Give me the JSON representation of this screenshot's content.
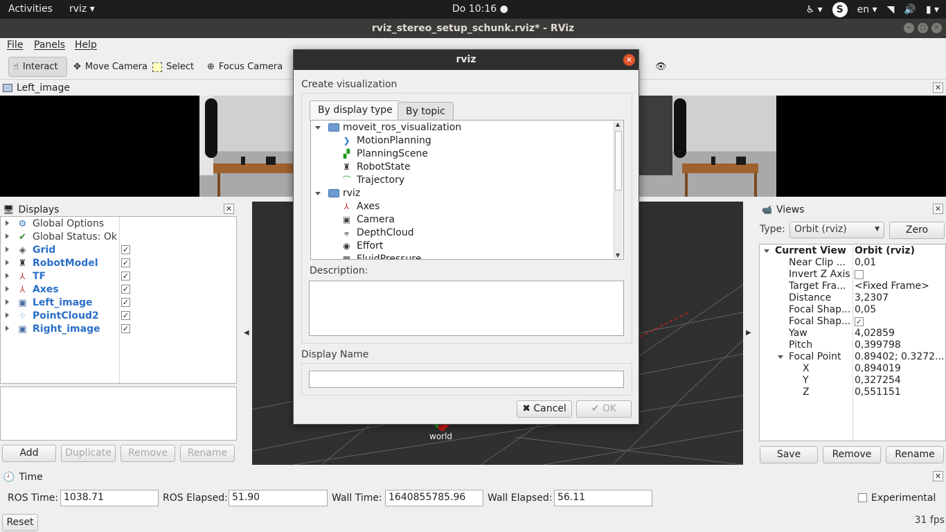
{
  "topbar": {
    "activities": "Activities",
    "app": "rviz ▾",
    "clock": "Do 10:16 ●",
    "lang": "en ▾"
  },
  "window": {
    "title": "rviz_stereo_setup_schunk.rviz* - RViz"
  },
  "menu": {
    "file": "File",
    "panels": "Panels",
    "help": "Help"
  },
  "toolbar": {
    "interact": "Interact",
    "move_camera": "Move Camera",
    "select": "Select",
    "focus_camera": "Focus Camera"
  },
  "left_image": {
    "title": "Left_image"
  },
  "displays": {
    "title": "Displays",
    "items": [
      {
        "label": "Global Options",
        "icon": "gear-icon",
        "bold": false,
        "checked": null
      },
      {
        "label": "Global Status: Ok",
        "icon": "checkmark-icon",
        "bold": false,
        "checked": null
      },
      {
        "label": "Grid",
        "icon": "grid-icon",
        "bold": true,
        "checked": true
      },
      {
        "label": "RobotModel",
        "icon": "robot-icon",
        "bold": true,
        "checked": true
      },
      {
        "label": "TF",
        "icon": "tf-icon",
        "bold": true,
        "checked": true
      },
      {
        "label": "Axes",
        "icon": "axes-icon",
        "bold": true,
        "checked": true
      },
      {
        "label": "Left_image",
        "icon": "image-icon",
        "bold": true,
        "checked": true
      },
      {
        "label": "PointCloud2",
        "icon": "pointcloud-icon",
        "bold": true,
        "checked": true
      },
      {
        "label": "Right_image",
        "icon": "image-icon",
        "bold": true,
        "checked": true
      }
    ],
    "buttons": {
      "add": "Add",
      "duplicate": "Duplicate",
      "remove": "Remove",
      "rename": "Rename"
    }
  },
  "view3d": {
    "frame_label": "world"
  },
  "views": {
    "title": "Views",
    "type_label": "Type:",
    "type_value": "Orbit (rviz)",
    "zero": "Zero",
    "rows": [
      {
        "name": "Current View",
        "value": "Orbit (rviz)",
        "indent": 0,
        "bold": true
      },
      {
        "name": "Near Clip ...",
        "value": "0,01",
        "indent": 1,
        "bold": false
      },
      {
        "name": "Invert Z Axis",
        "value": "",
        "indent": 1,
        "bold": false
      },
      {
        "name": "Target Fra...",
        "value": "<Fixed Frame>",
        "indent": 1,
        "bold": false
      },
      {
        "name": "Distance",
        "value": "3,2307",
        "indent": 1,
        "bold": false
      },
      {
        "name": "Focal Shap...",
        "value": "0,05",
        "indent": 1,
        "bold": false
      },
      {
        "name": "Focal Shap...",
        "value": "",
        "indent": 1,
        "bold": false
      },
      {
        "name": "Yaw",
        "value": "4,02859",
        "indent": 1,
        "bold": false
      },
      {
        "name": "Pitch",
        "value": "0,399798",
        "indent": 1,
        "bold": false
      },
      {
        "name": "Focal Point",
        "value": "0.89402; 0.3272...",
        "indent": 1,
        "bold": false
      },
      {
        "name": "X",
        "value": "0,894019",
        "indent": 2,
        "bold": false
      },
      {
        "name": "Y",
        "value": "0,327254",
        "indent": 2,
        "bold": false
      },
      {
        "name": "Z",
        "value": "0,551151",
        "indent": 2,
        "bold": false
      }
    ],
    "buttons": {
      "save": "Save",
      "remove": "Remove",
      "rename": "Rename"
    }
  },
  "time": {
    "title": "Time",
    "ros_time_label": "ROS Time:",
    "ros_time": "1038.71",
    "ros_elapsed_label": "ROS Elapsed:",
    "ros_elapsed": "51.90",
    "wall_time_label": "Wall Time:",
    "wall_time": "1640855785.96",
    "wall_elapsed_label": "Wall Elapsed:",
    "wall_elapsed": "56.11",
    "experimental": "Experimental",
    "reset": "Reset",
    "fps": "31 fps"
  },
  "dialog": {
    "title": "rviz",
    "group_title": "Create visualization",
    "tab_display_type": "By display type",
    "tab_topic": "By topic",
    "tree": [
      {
        "label": "moveit_ros_visualization",
        "kind": "folder"
      },
      {
        "label": "MotionPlanning",
        "kind": "item",
        "icon": "motion-planning-icon"
      },
      {
        "label": "PlanningScene",
        "kind": "item",
        "icon": "planning-scene-icon"
      },
      {
        "label": "RobotState",
        "kind": "item",
        "icon": "robot-state-icon"
      },
      {
        "label": "Trajectory",
        "kind": "item",
        "icon": "trajectory-icon"
      },
      {
        "label": "rviz",
        "kind": "folder"
      },
      {
        "label": "Axes",
        "kind": "item",
        "icon": "axes-icon"
      },
      {
        "label": "Camera",
        "kind": "item",
        "icon": "camera-icon"
      },
      {
        "label": "DepthCloud",
        "kind": "item",
        "icon": "depth-cloud-icon"
      },
      {
        "label": "Effort",
        "kind": "item",
        "icon": "effort-icon"
      },
      {
        "label": "FluidPressure",
        "kind": "item",
        "icon": "fluid-pressure-icon"
      }
    ],
    "description_label": "Description:",
    "display_name_label": "Display Name",
    "display_name_value": "",
    "cancel": "Cancel",
    "ok": "OK"
  }
}
